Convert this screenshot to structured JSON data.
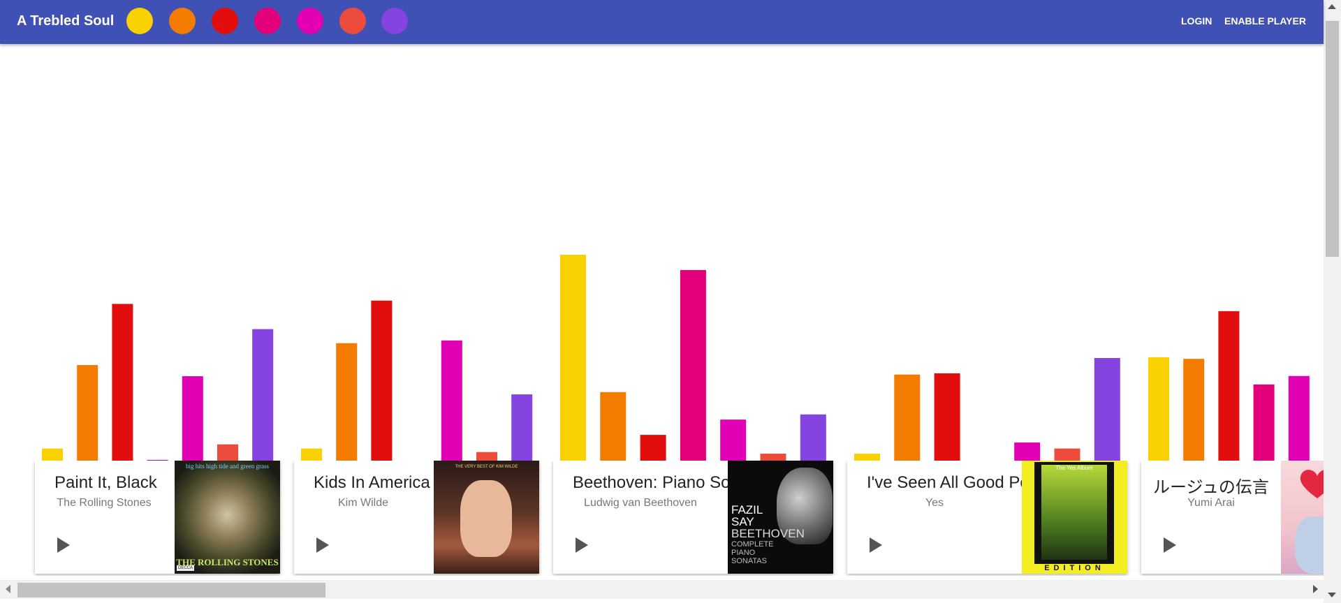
{
  "app": {
    "title": "A Trebled Soul",
    "swatches": [
      "#f9d100",
      "#f37b00",
      "#e20e0e",
      "#e4007b",
      "#e100b4",
      "#ec4c3c",
      "#8543e0"
    ],
    "login_label": "LOGIN",
    "enable_player_label": "ENABLE PLAYER",
    "brand_color": "#3f51b5"
  },
  "chart_data": {
    "type": "bar",
    "title": "",
    "groups": [
      {
        "name": "Paint It, Black",
        "values": [
          {
            "color": "#f9d100",
            "value": 0.062
          },
          {
            "color": "#f37b00",
            "value": 0.466
          },
          {
            "color": "#e20e0e",
            "value": 0.762
          },
          {
            "color": "#e4007b",
            "value": 0.004
          },
          {
            "color": "#e100b4",
            "value": 0.412
          },
          {
            "color": "#ec4c3c",
            "value": 0.082
          },
          {
            "color": "#8543e0",
            "value": 0.64
          }
        ]
      },
      {
        "name": "Kids In America",
        "values": [
          {
            "color": "#f9d100",
            "value": 0.062
          },
          {
            "color": "#f37b00",
            "value": 0.572
          },
          {
            "color": "#e20e0e",
            "value": 0.778
          },
          {
            "color": "#e4007b",
            "value": 0.0
          },
          {
            "color": "#e100b4",
            "value": 0.585
          },
          {
            "color": "#ec4c3c",
            "value": 0.045
          },
          {
            "color": "#8543e0",
            "value": 0.324
          }
        ]
      },
      {
        "name": "Beethoven: Piano Sonatas",
        "values": [
          {
            "color": "#f9d100",
            "value": 1.0
          },
          {
            "color": "#f37b00",
            "value": 0.335
          },
          {
            "color": "#e20e0e",
            "value": 0.128
          },
          {
            "color": "#e4007b",
            "value": 0.926
          },
          {
            "color": "#e100b4",
            "value": 0.202
          },
          {
            "color": "#ec4c3c",
            "value": 0.037
          },
          {
            "color": "#8543e0",
            "value": 0.227
          }
        ]
      },
      {
        "name": "I've Seen All Good People",
        "values": [
          {
            "color": "#f9d100",
            "value": 0.037
          },
          {
            "color": "#f37b00",
            "value": 0.42
          },
          {
            "color": "#e20e0e",
            "value": 0.426
          },
          {
            "color": "#e4007b",
            "value": 0.0
          },
          {
            "color": "#e100b4",
            "value": 0.091
          },
          {
            "color": "#ec4c3c",
            "value": 0.062
          },
          {
            "color": "#8543e0",
            "value": 0.5
          }
        ]
      },
      {
        "name": "ルージュの伝言",
        "values": [
          {
            "color": "#f9d100",
            "value": 0.504
          },
          {
            "color": "#f37b00",
            "value": 0.496
          },
          {
            "color": "#e20e0e",
            "value": 0.727
          },
          {
            "color": "#e4007b",
            "value": 0.372
          },
          {
            "color": "#e100b4",
            "value": 0.413
          }
        ]
      }
    ]
  },
  "cards": [
    {
      "title": "Paint It, Black",
      "artist": "The Rolling Stones",
      "cover": "big hits (high tide and green grass)"
    },
    {
      "title": "Kids In America",
      "artist": "Kim Wilde",
      "cover": "THE VERY BEST OF KIM WILDE"
    },
    {
      "title": "Beethoven: Piano Son",
      "artist": "Ludwig van Beethoven",
      "cover": "FAZIL SAY BEETHOVEN"
    },
    {
      "title": "I've Seen All Good Peo",
      "artist": "Yes",
      "cover": "The Yes Album"
    },
    {
      "title": "ルージュの伝言",
      "artist": "Yumi Arai",
      "cover": "heart"
    }
  ],
  "cover_text": {
    "rs_top": "big hits  high tide and green grass",
    "rs_bottom": "THE ROLLING STONES",
    "rs_label": "DECCA",
    "kw_top": "THE VERY BEST OF KIM WILDE",
    "fs_line1": "FAZIL",
    "fs_line2": "SAY",
    "fs_line3": "BEETHOVEN",
    "fs_line4": "COMPLETE",
    "fs_line5": "PIANO",
    "fs_line6": "SONATAS",
    "yes_title": "The Yes Album",
    "yes_edition": "EDITION"
  }
}
